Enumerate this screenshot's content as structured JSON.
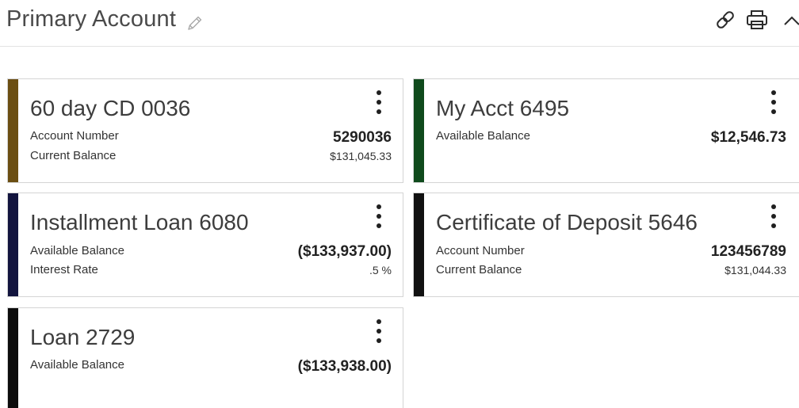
{
  "header": {
    "title": "Primary Account",
    "icons": [
      "edit-icon",
      "link-icon",
      "print-icon",
      "chevron-up-icon"
    ]
  },
  "accounts": [
    {
      "name": "60 day CD 0036",
      "stripe_color": "#6b4e12",
      "rows": [
        {
          "label": "Account Number",
          "value": "5290036"
        },
        {
          "label": "Current Balance",
          "value": "$131,045.33"
        }
      ]
    },
    {
      "name": "My Acct 6495",
      "stripe_color": "#0f4a1c",
      "rows": [
        {
          "label": "Available Balance",
          "value": "$12,546.73"
        }
      ]
    },
    {
      "name": "Installment Loan 6080",
      "stripe_color": "#12143e",
      "rows": [
        {
          "label": "Available Balance",
          "value": "($133,937.00)"
        },
        {
          "label": "Interest Rate",
          "value": ".5 %"
        }
      ]
    },
    {
      "name": "Certificate of Deposit 5646",
      "stripe_color": "#111111",
      "rows": [
        {
          "label": "Account Number",
          "value": "123456789"
        },
        {
          "label": "Current Balance",
          "value": "$131,044.33"
        }
      ]
    },
    {
      "name": "Loan 2729",
      "stripe_color": "#0c0c0c",
      "rows": [
        {
          "label": "Available Balance",
          "value": "($133,938.00)"
        }
      ]
    }
  ]
}
